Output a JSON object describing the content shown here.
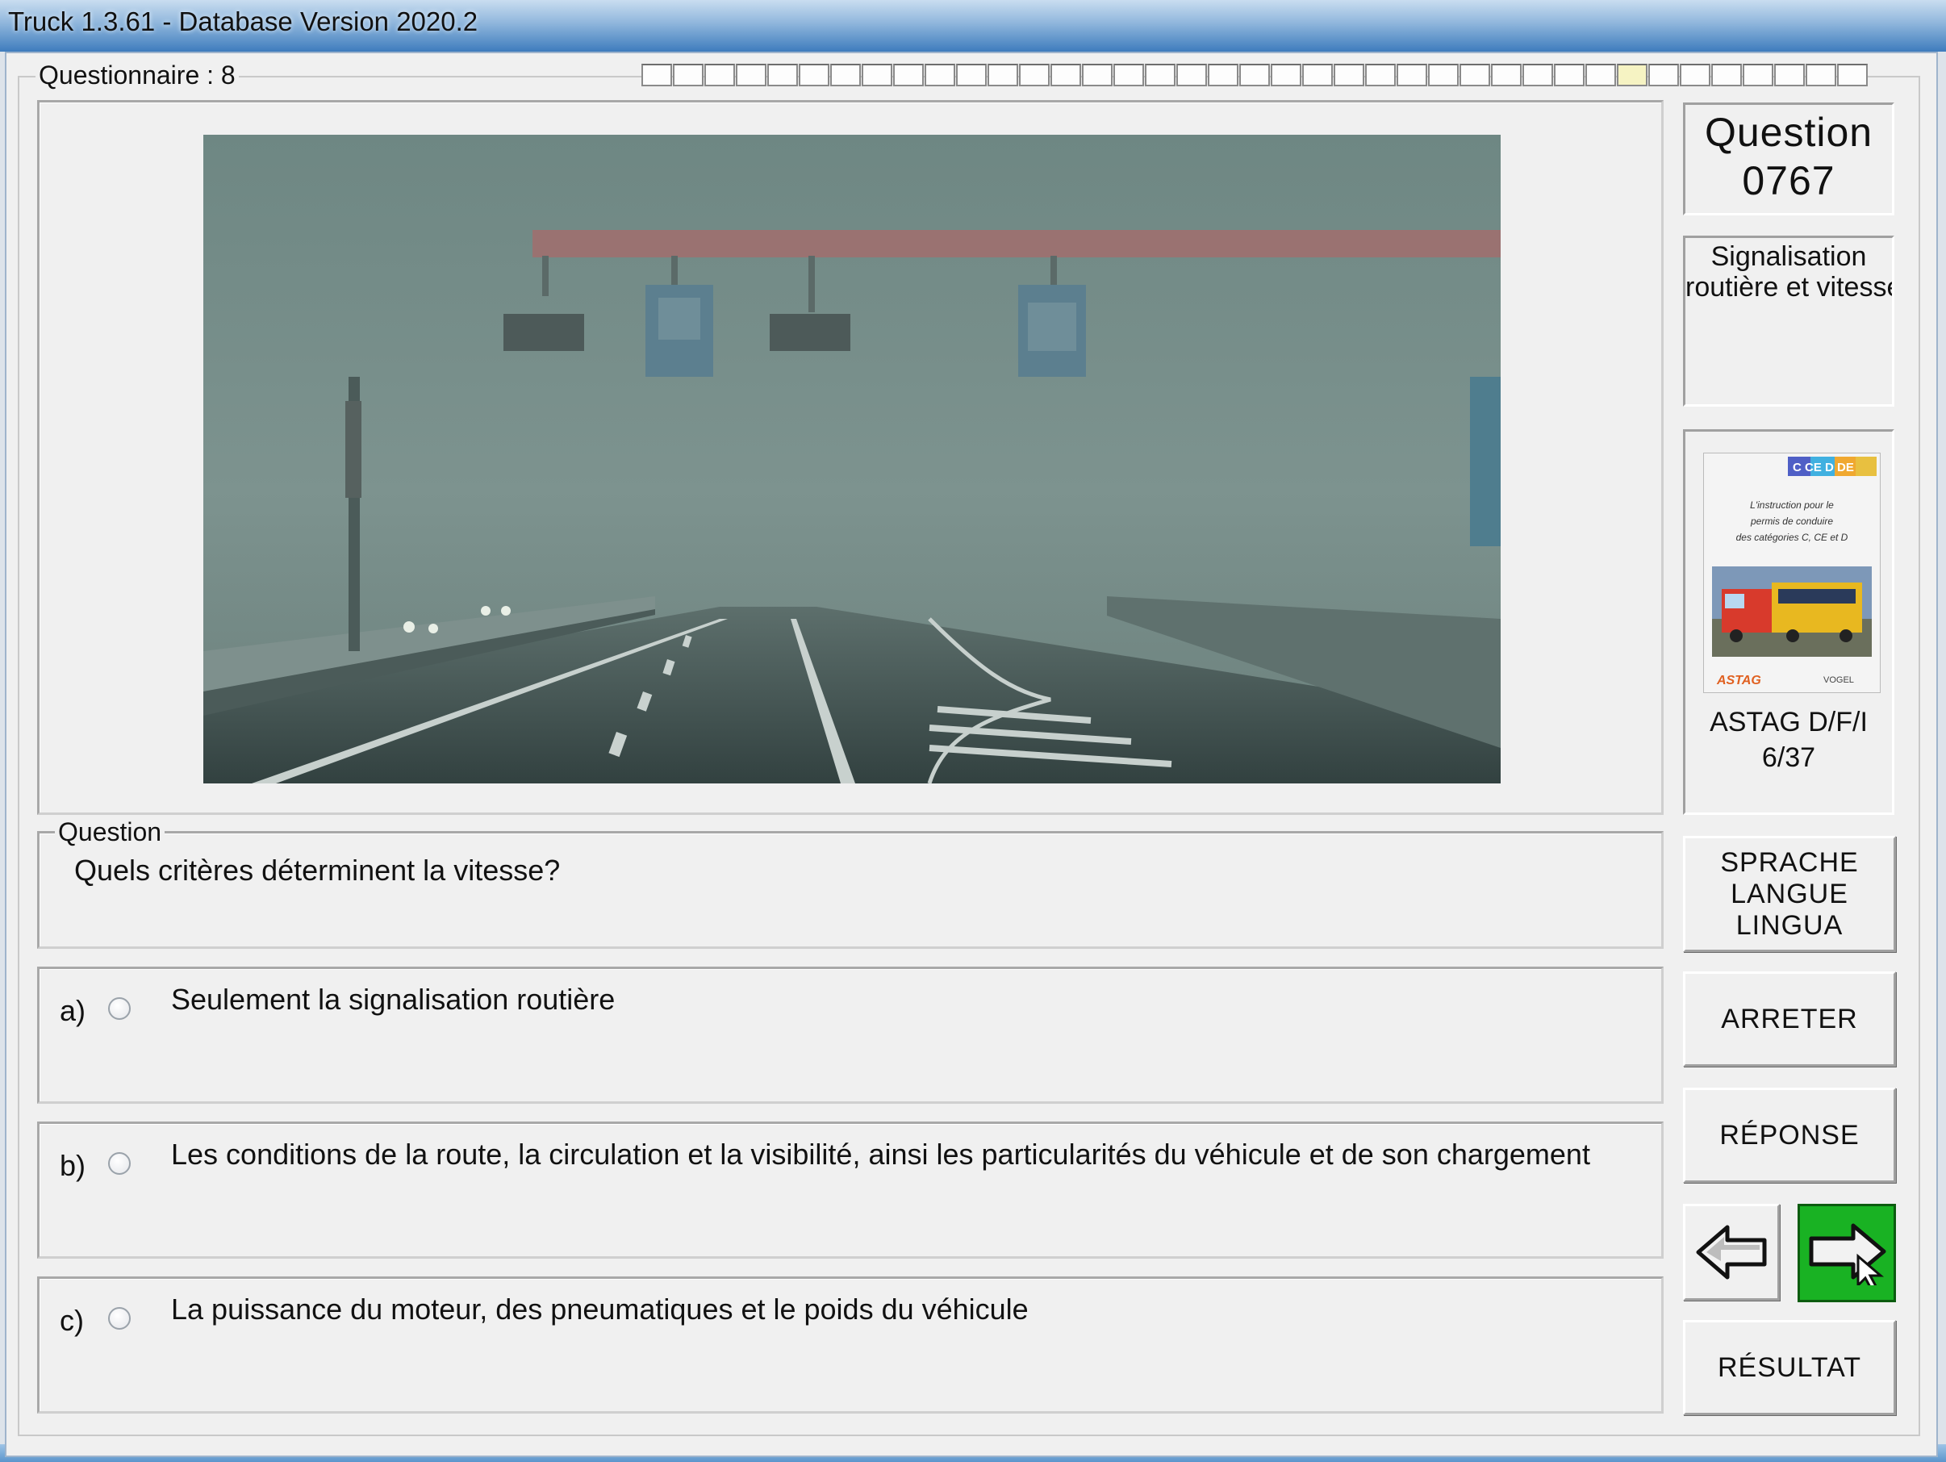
{
  "window": {
    "title": "Truck 1.3.61 - Database Version 2020.2"
  },
  "questionnaire": {
    "label": "Questionnaire : 8",
    "progress_total": 39,
    "progress_current": 31
  },
  "question_panel": {
    "group_label": "Question",
    "text": "Quels critères déterminent la vitesse?"
  },
  "answers": [
    {
      "letter": "a)",
      "text": "Seulement la signalisation routière"
    },
    {
      "letter": "b)",
      "text": "Les conditions de la route, la circulation et la visibilité, ainsi les particularités du véhicule et de son chargement"
    },
    {
      "letter": "c)",
      "text": "La puissance du moteur, des pneumatiques et le poids du véhicule"
    }
  ],
  "sidebar": {
    "question_word": "Question",
    "question_number": "0767",
    "category_line1": "Signalisation",
    "category_line2": "routière et vitesse",
    "book_caption_line1": "ASTAG D/F/I",
    "book_caption_line2": "6/37",
    "book_cover": {
      "badge": "C CE D DE",
      "text_line1": "L'instruction pour le",
      "text_line2": "permis de conduire",
      "text_line3": "des catégories C, CE et D",
      "logo_left": "ASTAG",
      "logo_right": "VOGEL"
    }
  },
  "buttons": {
    "language_line1": "SPRACHE",
    "language_line2": "LANGUE",
    "language_line3": "LINGUA",
    "stop": "ARRETER",
    "answer": "RÉPONSE",
    "result": "RÉSULTAT"
  },
  "colors": {
    "next_button_green": "#19b223",
    "title_gradient_top": "#c9ddf0",
    "title_gradient_bottom": "#3e7cbd",
    "progress_current": "#f6f3c3"
  }
}
